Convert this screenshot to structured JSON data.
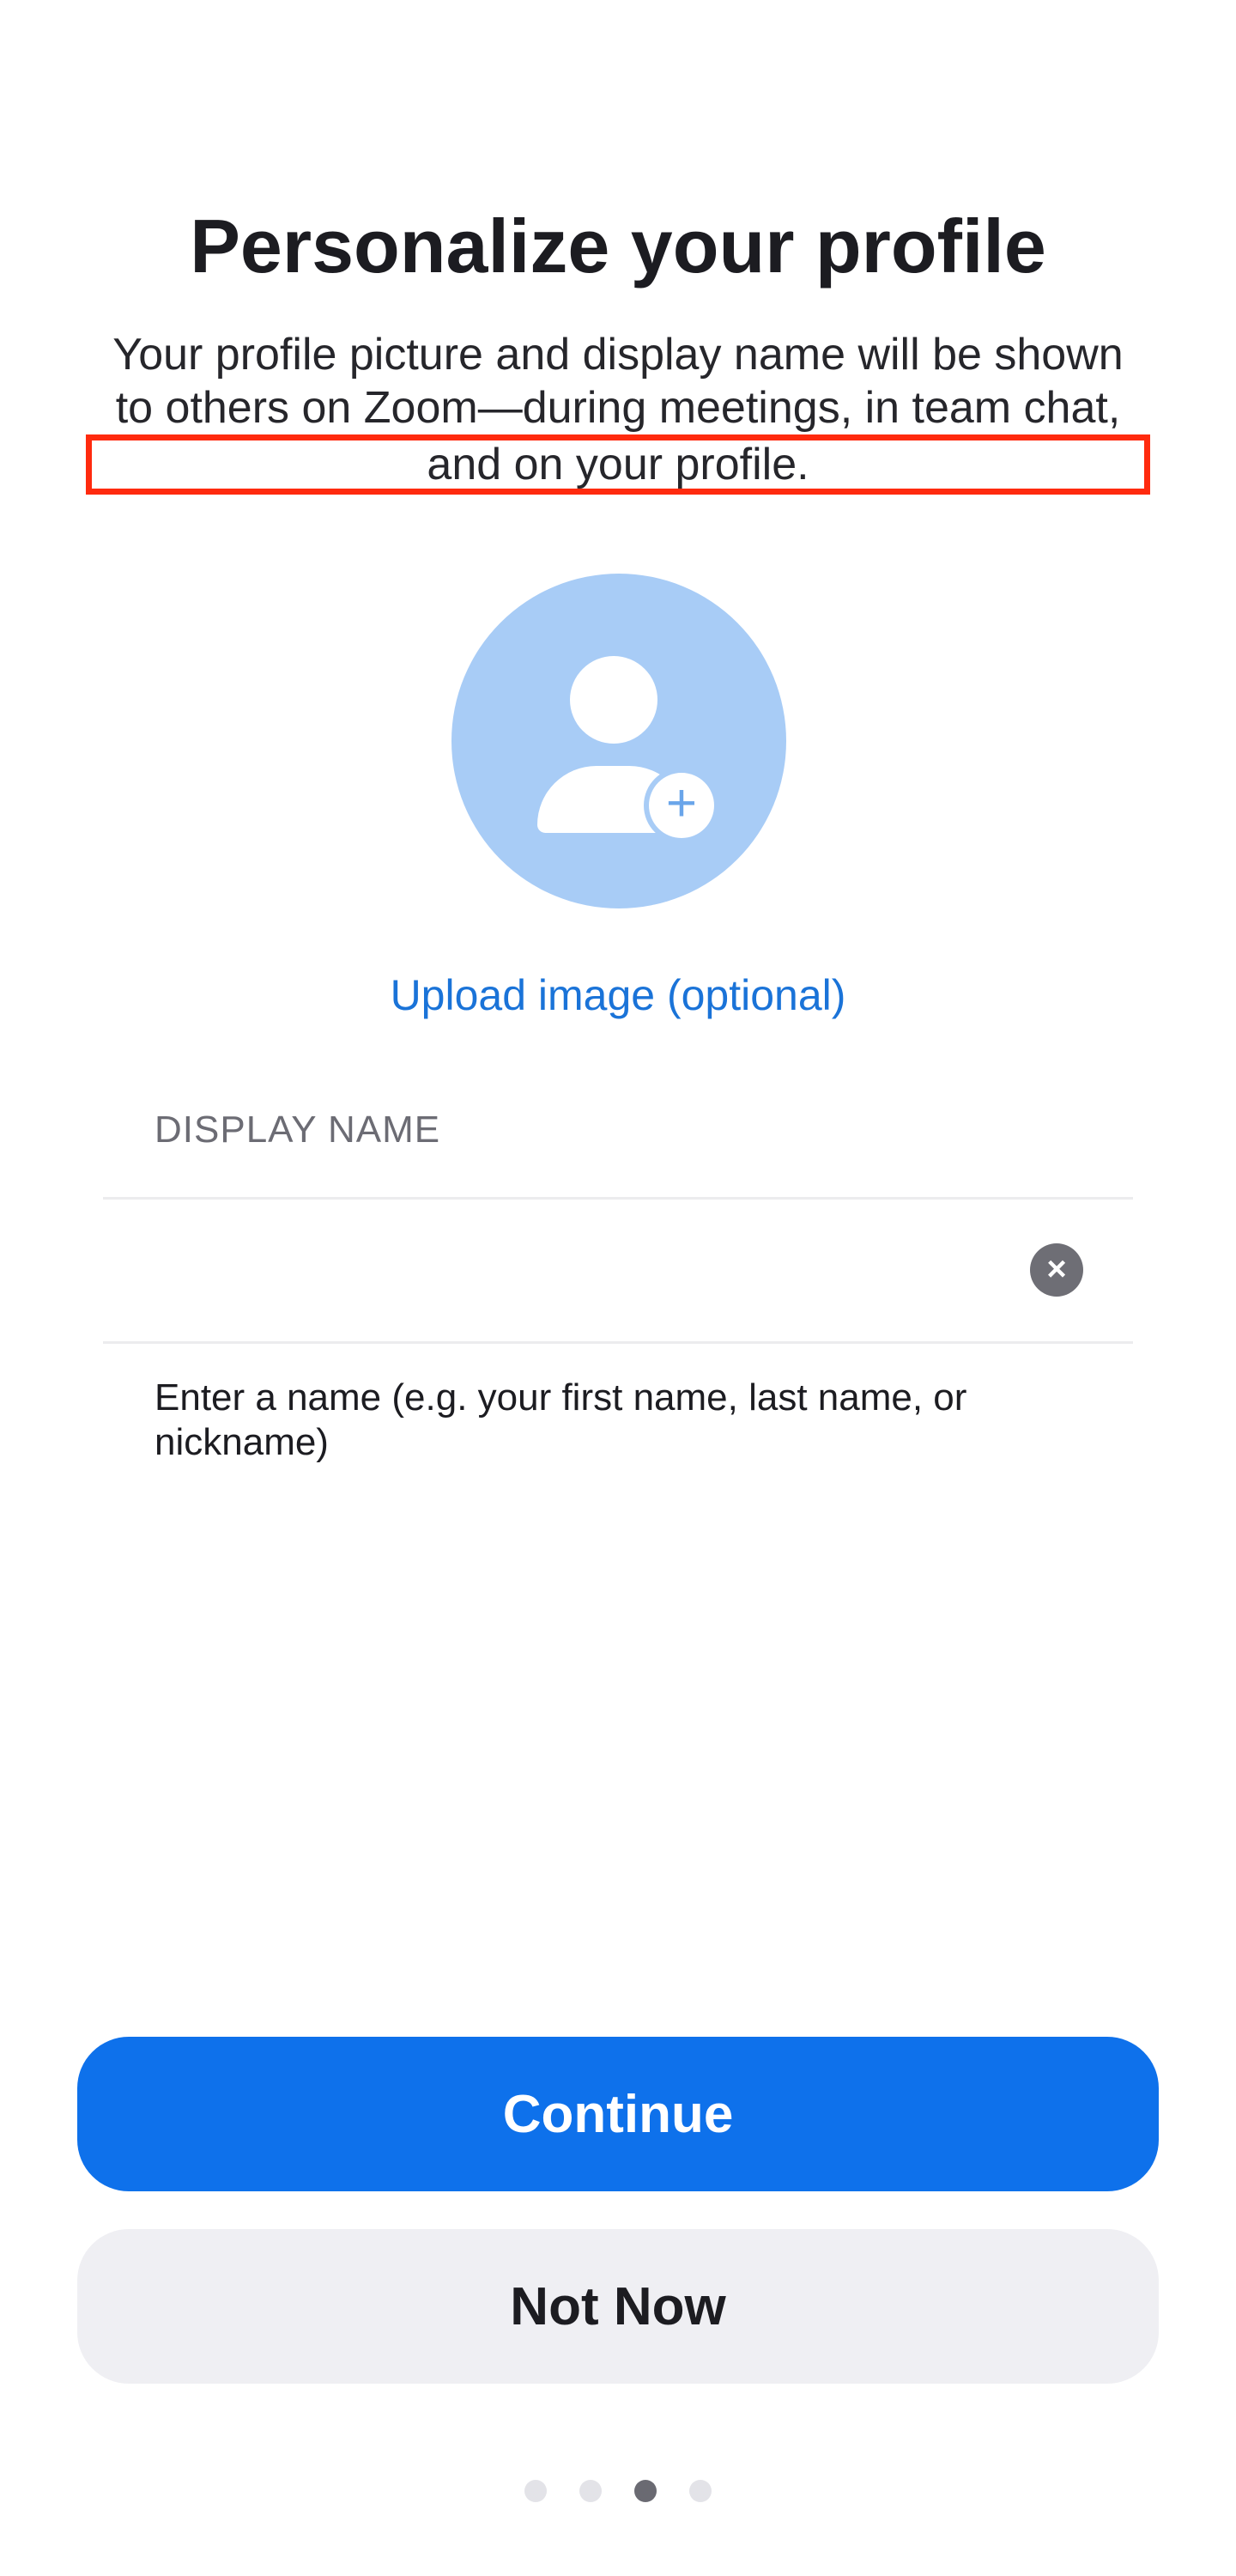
{
  "header": {
    "title": "Personalize your profile",
    "subtitle_line1": "Your profile picture and display name will be shown",
    "subtitle_line2": "to others on Zoom—during meetings, in team chat,",
    "subtitle_line3": "and on your profile."
  },
  "avatar": {
    "icon": "person-add-icon",
    "plus_glyph": "+",
    "upload_label": "Upload image (optional)"
  },
  "display_name": {
    "label": "DISPLAY NAME",
    "value": "",
    "clear_glyph": "×",
    "helper": "Enter a name (e.g. your first name, last name, or nickname)"
  },
  "actions": {
    "continue_label": "Continue",
    "not_now_label": "Not Now"
  },
  "pagination": {
    "total": 4,
    "current": 3
  },
  "colors": {
    "accent": "#0E71EB",
    "link": "#1A73D8",
    "avatar_bg": "#A8CCF6",
    "highlight_box": "#FF2A0E",
    "secondary_button_bg": "#EFEFF3"
  }
}
